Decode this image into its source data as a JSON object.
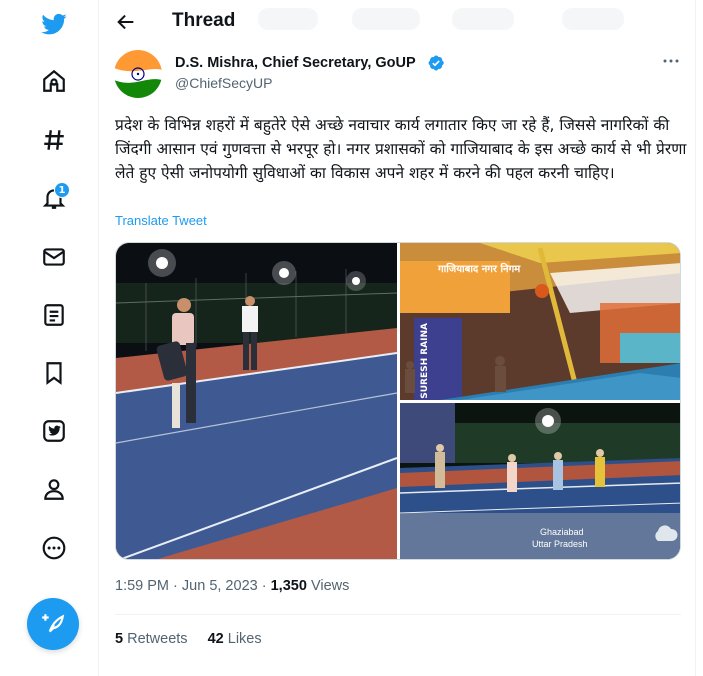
{
  "header": {
    "title": "Thread"
  },
  "nav": [
    {
      "name": "twitter-logo-icon"
    },
    {
      "name": "home-icon"
    },
    {
      "name": "explore-hashtag-icon"
    },
    {
      "name": "notifications-bell-icon",
      "badge": "1"
    },
    {
      "name": "messages-envelope-icon"
    },
    {
      "name": "lists-icon"
    },
    {
      "name": "bookmarks-icon"
    },
    {
      "name": "twitter-blue-icon"
    },
    {
      "name": "profile-icon"
    },
    {
      "name": "more-options-icon"
    }
  ],
  "tweet": {
    "author_name": "D.S. Mishra, Chief Secretary, GoUP",
    "author_handle": "@ChiefSecyUP",
    "text": "प्रदेश के विभिन्न शहरों में बहुतेरे ऐसे अच्छे नवाचार कार्य लगातार किए जा रहे हैं, जिससे नागरिकों की जिंदगी आसान एवं गुणवत्ता से भरपूर हो। नगर प्रशासकों को गाजियाबाद के इस अच्छे कार्य से भी प्रेरणा लेते हुए ऐसी जनोपयोगी सुविधाओं का विकास अपने शहर में करने की पहल करनी चाहिए।",
    "translate_label": "Translate Tweet",
    "photos": [
      {
        "name": "photo-outdoor-court-night"
      },
      {
        "name": "photo-indoor-court-arena",
        "sign_text": "गाजियाबाद नगर निगम",
        "banner_text": "SURESH RAINA"
      },
      {
        "name": "photo-court-players-group",
        "caption_city": "Ghaziabad",
        "caption_state": "Uttar Pradesh"
      }
    ],
    "time": "1:59 PM",
    "date": "Jun 5, 2023",
    "sep": "·",
    "views_count": "1,350",
    "views_label": "Views",
    "retweets_count": "5",
    "retweets_label": "Retweets",
    "likes_count": "42",
    "likes_label": "Likes"
  },
  "colors": {
    "accent": "#1d9bf0",
    "text": "#0f1419",
    "muted": "#536471",
    "border": "#eff3f4"
  }
}
